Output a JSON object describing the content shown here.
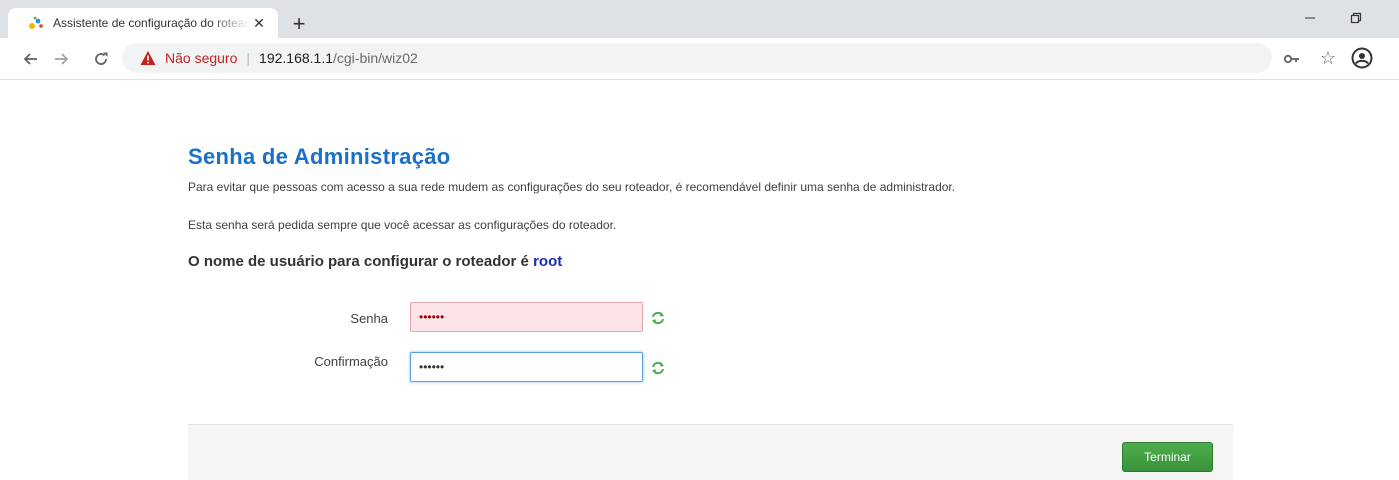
{
  "browser": {
    "tab": {
      "title": "Assistente de configuração do roteador",
      "close": "✕"
    },
    "new_tab": "+",
    "address": {
      "security_label": "Não seguro",
      "separator": "|",
      "host": "192.168.1.1",
      "path": "/cgi-bin/wiz02"
    },
    "star": "☆"
  },
  "page": {
    "title": "Senha de Administração",
    "description_1": "Para evitar que pessoas com acesso a sua rede mudem as configurações do seu roteador, é recomendável definir uma senha de administrador.",
    "description_2": "Esta senha será pedida sempre que você acessar as configurações do roteador.",
    "username_prefix": "O nome de usuário para configurar o roteador é ",
    "username": "root",
    "fields": {
      "password": {
        "label": "Senha",
        "value": "••••••"
      },
      "confirmation": {
        "label": "Confirmação",
        "value": "••••••"
      }
    },
    "finish_button": "Terminar"
  },
  "colors": {
    "title": "#1a6fc9",
    "insecure": "#c5221f",
    "username": "#1a2cb0",
    "finish_button": "#3a9b3a",
    "invalid_field_bg": "#fde4e8"
  }
}
